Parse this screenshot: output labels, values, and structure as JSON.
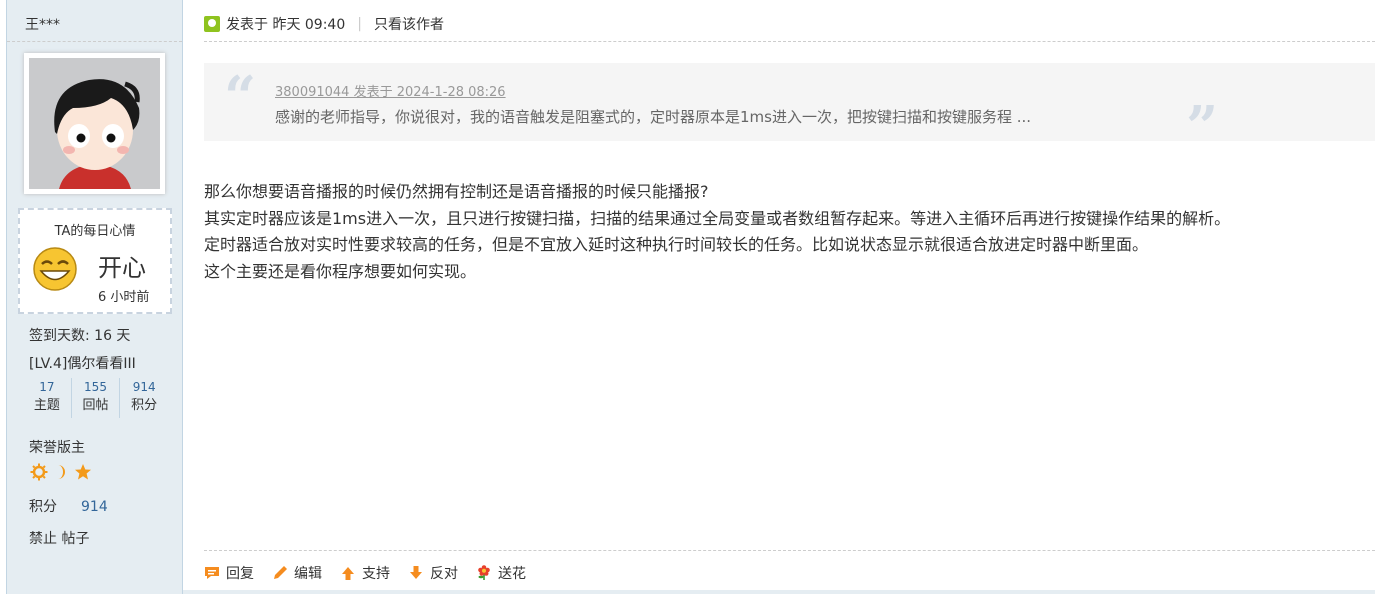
{
  "author": {
    "name": "王***",
    "mood": {
      "title": "TA的每日心情",
      "word": "开心",
      "time": "6 小时前"
    },
    "signin": "签到天数: 16 天",
    "level": "[LV.4]偶尔看看III",
    "counts": [
      {
        "num": "17",
        "label": "主题"
      },
      {
        "num": "155",
        "label": "回帖"
      },
      {
        "num": "914",
        "label": "积分"
      }
    ],
    "rank": "荣誉版主",
    "medals": [
      "sun-medal-icon",
      "moon-medal-icon",
      "star-medal-icon"
    ],
    "credits_label": "积分",
    "credits_value": "914",
    "bans": "禁止 帖子"
  },
  "post": {
    "posted_label": "发表于",
    "posted_time": "昨天 09:40",
    "separator": "|",
    "only_author": "只看该作者",
    "quote": {
      "source": "380091044 发表于 2024-1-28 08:26",
      "text": "感谢的老师指导，你说很对，我的语音触发是阻塞式的，定时器原本是1ms进入一次，把按键扫描和按键服务程 ..."
    },
    "lines": [
      "那么你想要语音播报的时候仍然拥有控制还是语音播报的时候只能播报?",
      "其实定时器应该是1ms进入一次，且只进行按键扫描，扫描的结果通过全局变量或者数组暂存起来。等进入主循环后再进行按键操作结果的解析。",
      "定时器适合放对实时性要求较高的任务，但是不宜放入延时这种执行时间较长的任务。比如说状态显示就很适合放进定时器中断里面。",
      "这个主要还是看你程序想要如何实现。"
    ],
    "actions": [
      {
        "label": "回复",
        "icon": "reply-icon"
      },
      {
        "label": "编辑",
        "icon": "edit-icon"
      },
      {
        "label": "支持",
        "icon": "support-icon"
      },
      {
        "label": "反对",
        "icon": "oppose-icon"
      },
      {
        "label": "送花",
        "icon": "flower-icon"
      }
    ]
  },
  "colors": {
    "sidebar_bg": "#e5edf2",
    "link_blue": "#336699",
    "online_green": "#8fc31f",
    "action_orange": "#f58c1f"
  }
}
